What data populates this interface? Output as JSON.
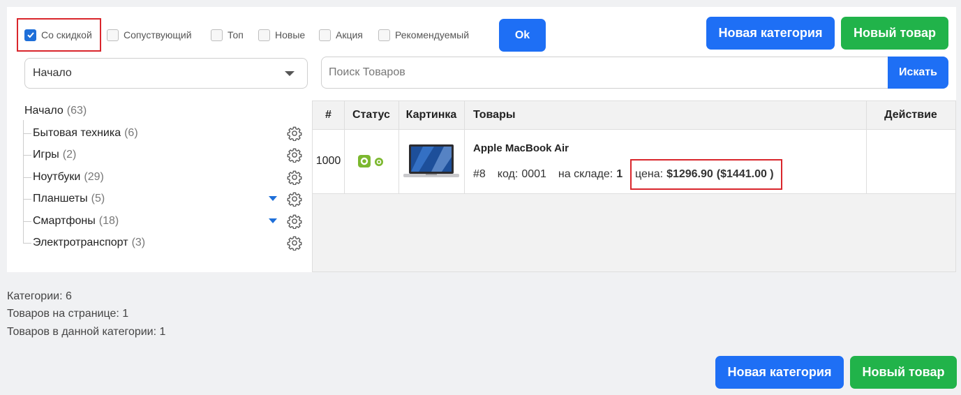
{
  "filters": [
    {
      "label": "Со скидкой",
      "checked": true
    },
    {
      "label": "Сопуствующий",
      "checked": false
    },
    {
      "label": "Топ",
      "checked": false
    },
    {
      "label": "Новые",
      "checked": false
    },
    {
      "label": "Акция",
      "checked": false
    },
    {
      "label": "Рекомендуемый",
      "checked": false
    }
  ],
  "ok_label": "Ok",
  "top_buttons": {
    "new_category": "Новая категория",
    "new_product": "Новый товар"
  },
  "category_select": {
    "value": "Начало"
  },
  "search": {
    "placeholder": "Поиск Товаров",
    "button": "Искать"
  },
  "tree": {
    "root": {
      "label": "Начало",
      "count": "(63)"
    },
    "items": [
      {
        "label": "Бытовая техника",
        "count": "(6)",
        "expandable": false
      },
      {
        "label": "Игры",
        "count": "(2)",
        "expandable": false
      },
      {
        "label": "Ноутбуки",
        "count": "(29)",
        "expandable": false
      },
      {
        "label": "Планшеты",
        "count": "(5)",
        "expandable": true
      },
      {
        "label": "Смартфоны",
        "count": "(18)",
        "expandable": true
      },
      {
        "label": "Электротранспорт",
        "count": "(3)",
        "expandable": false
      }
    ]
  },
  "table": {
    "headers": {
      "num": "#",
      "status": "Статус",
      "image": "Картинка",
      "products": "Товары",
      "action": "Действие"
    },
    "rows": [
      {
        "num": "1000",
        "name": "Apple MacBook Air",
        "id": "#8",
        "code_label": "код:",
        "code": "0001",
        "stock_label": "на складе:",
        "stock": "1",
        "price_label": "цена:",
        "price": "$1296.90",
        "old_price": "($1441.00 )"
      }
    ]
  },
  "summary": {
    "categories": "Категории: 6",
    "per_page": "Товаров на странице: 1",
    "in_category": "Товаров в данной категории: 1"
  },
  "bottom_buttons": {
    "new_category": "Новая категория",
    "new_product": "Новый товар"
  },
  "colors": {
    "blue": "#1e6ff5",
    "green": "#21b34a",
    "highlight": "#d9262c",
    "status_green": "#7cb82f"
  }
}
